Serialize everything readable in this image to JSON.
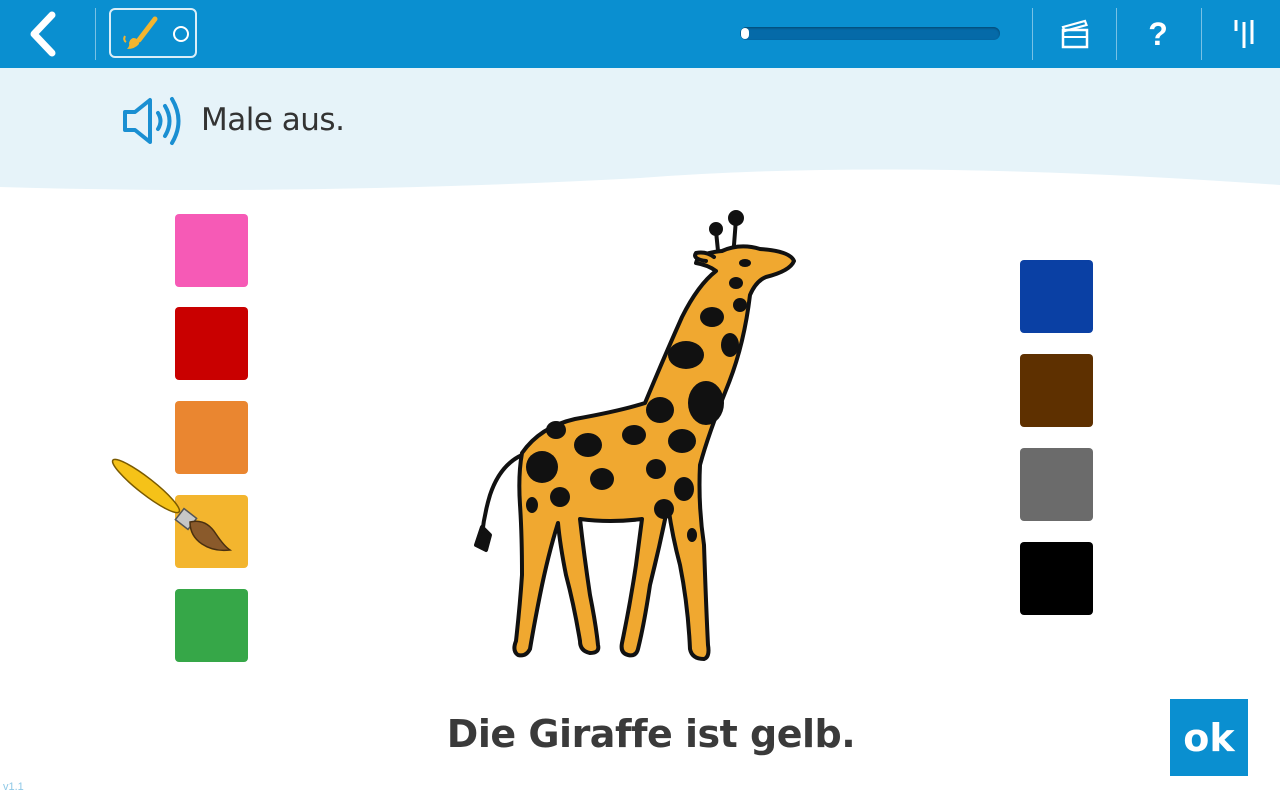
{
  "topbar": {
    "back_icon": "chevron-left-icon",
    "mode_icons": [
      "paintbrush-icon",
      "circle-icon"
    ],
    "progress": 0.03,
    "film_icon": "clapperboard-icon",
    "help_label": "?",
    "menu_icon": "tally-icon"
  },
  "instruction": {
    "speaker_icon": "speaker-icon",
    "text": "Male aus."
  },
  "palette": {
    "left": [
      {
        "name": "pink",
        "color": "#f65ab6"
      },
      {
        "name": "red",
        "color": "#c90000"
      },
      {
        "name": "orange",
        "color": "#ea8630"
      },
      {
        "name": "yellow",
        "color": "#f3b52e",
        "selected": true
      },
      {
        "name": "green",
        "color": "#36a748"
      }
    ],
    "right": [
      {
        "name": "blue",
        "color": "#0a40a4"
      },
      {
        "name": "brown",
        "color": "#5e3000"
      },
      {
        "name": "gray",
        "color": "#6b6b6b"
      },
      {
        "name": "black",
        "color": "#000000"
      }
    ]
  },
  "picture": {
    "subject": "giraffe",
    "fill_color": "#f0a830"
  },
  "sentence": "Die Giraffe ist gelb.",
  "ok_label": "ok",
  "version": "v1.1",
  "colors": {
    "accent": "#0a8fd0",
    "band": "#e6f3f9"
  }
}
